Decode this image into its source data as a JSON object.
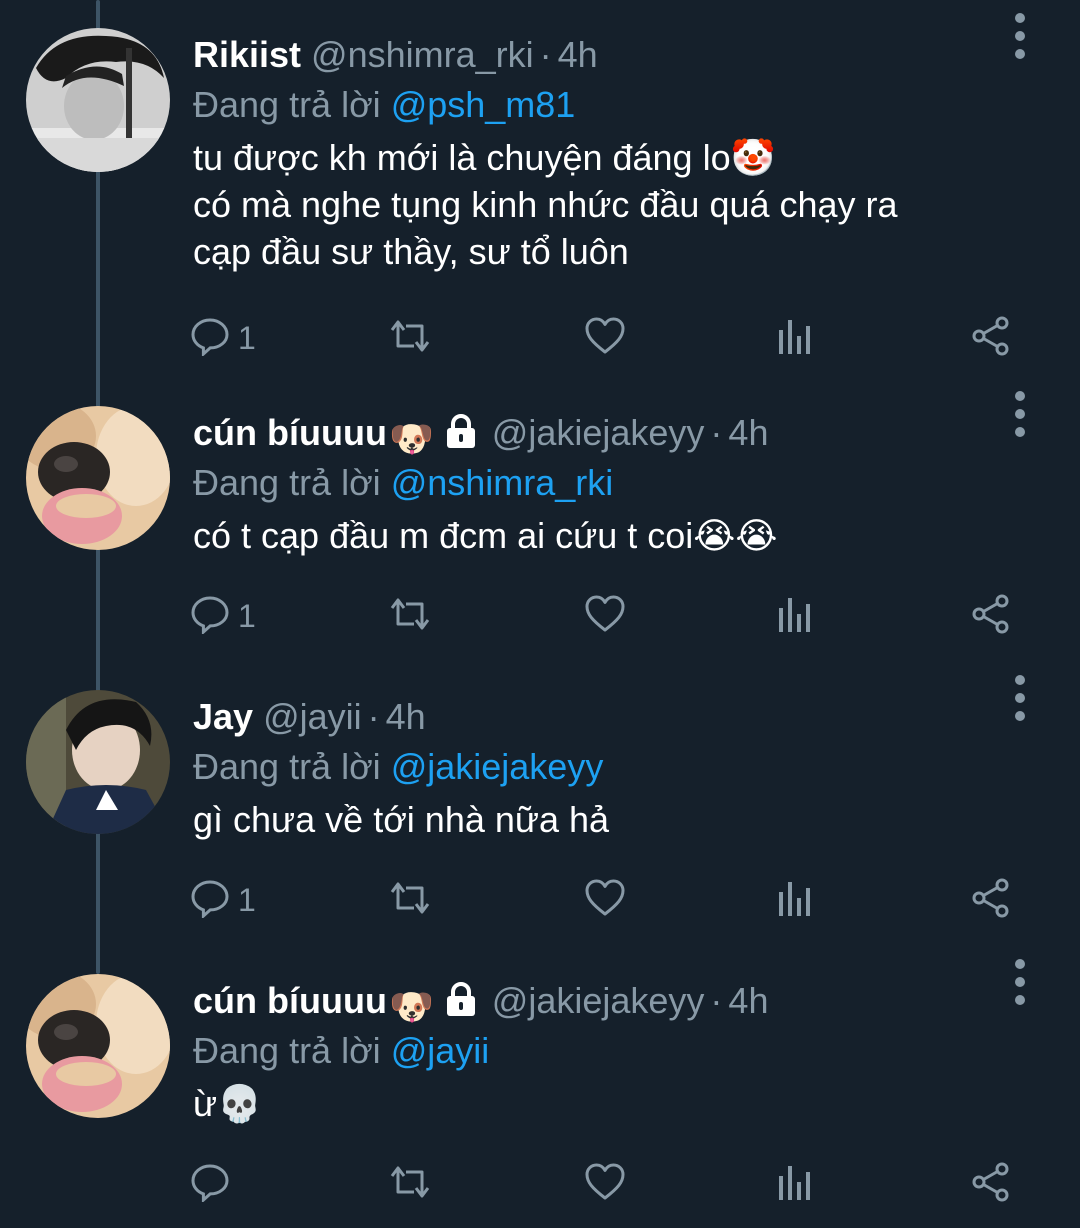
{
  "colors": {
    "background": "#15202b",
    "text": "#ffffff",
    "secondary": "#8899a6",
    "accent": "#1da1f2",
    "thread_line": "#3d5466"
  },
  "tweets": [
    {
      "display_name": "Rikiist",
      "name_emoji": "",
      "protected": false,
      "handle": "@nshimra_rki",
      "dot": "·",
      "time": "4h",
      "reply_prefix": "Đang trả lời",
      "reply_to": "@psh_m81",
      "lines": [
        "tu được kh mới là chuyện đáng lo🤡",
        "có mà nghe tụng kinh nhức đầu quá chạy ra",
        "cạp đầu sư thầy, sư tổ luôn"
      ],
      "reply_count": "1",
      "avatar": "avatar-boy-grayscale"
    },
    {
      "display_name": "cún bíuuuu",
      "name_emoji": "🐶",
      "protected": true,
      "handle": "@jakiejakeyy",
      "dot": "·",
      "time": "4h",
      "reply_prefix": "Đang trả lời",
      "reply_to": "@nshimra_rki",
      "lines": [
        "có t cạp đầu m đcm ai cứu t coi😭😭"
      ],
      "reply_count": "1",
      "avatar": "avatar-dog-nose"
    },
    {
      "display_name": "Jay",
      "name_emoji": "",
      "protected": false,
      "handle": "@jayii",
      "dot": "·",
      "time": "4h",
      "reply_prefix": "Đang trả lời",
      "reply_to": "@jakiejakeyy",
      "lines": [
        "gì chưa về tới nhà nữa hả"
      ],
      "reply_count": "1",
      "avatar": "avatar-boy-smile"
    },
    {
      "display_name": "cún bíuuuu",
      "name_emoji": "🐶",
      "protected": true,
      "handle": "@jakiejakeyy",
      "dot": "·",
      "time": "4h",
      "reply_prefix": "Đang trả lời",
      "reply_to": "@jayii",
      "lines": [
        "ừ💀"
      ],
      "reply_count": "",
      "avatar": "avatar-dog-nose"
    }
  ]
}
